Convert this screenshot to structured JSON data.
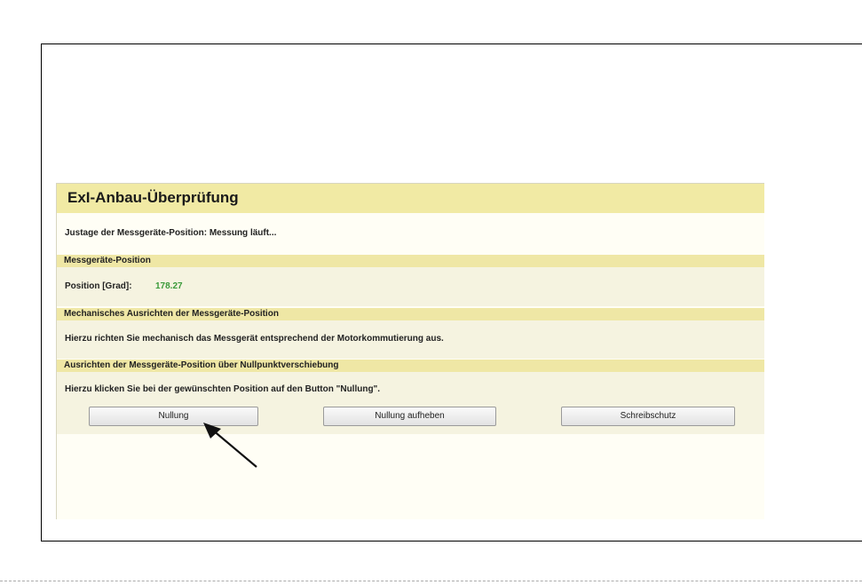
{
  "page_title": "ExI-Anbau-Überprüfung",
  "status_text": "Justage der Messgeräte-Position: Messung läuft...",
  "sections": {
    "position": {
      "header": "Messgeräte-Position",
      "label": "Position [Grad]:",
      "value": "178.27"
    },
    "mechanical": {
      "header": "Mechanisches Ausrichten der Messgeräte-Position",
      "text": "Hierzu richten Sie mechanisch das Messgerät entsprechend der Motorkommutierung aus."
    },
    "zero_shift": {
      "header": "Ausrichten der Messgeräte-Position über Nullpunktverschiebung",
      "text": "Hierzu klicken Sie bei der gewünschten Position auf den Button \"Nullung\"."
    }
  },
  "buttons": {
    "nullung": "Nullung",
    "nullung_aufheben": "Nullung aufheben",
    "schreibschutz": "Schreibschutz"
  },
  "colors": {
    "title_bar": "#f1eaa4",
    "section_header": "#efe7a5",
    "section_body": "#f5f3e0",
    "position_value": "#3a9a3a"
  },
  "icons": {
    "pointer": "arrow-pointer-icon"
  }
}
